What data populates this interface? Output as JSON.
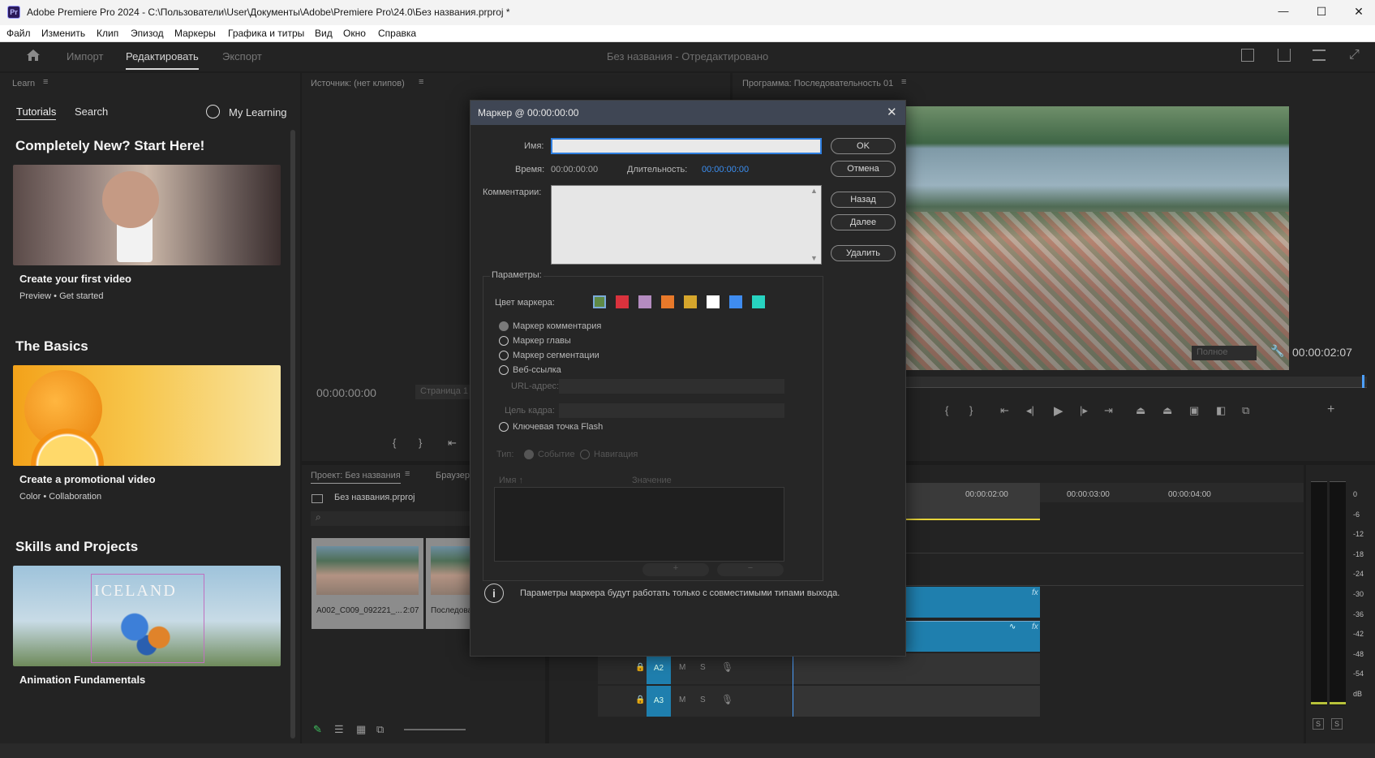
{
  "window": {
    "app_icon": "Pr",
    "title": "Adobe Premiere Pro 2024 - C:\\Пользователи\\User\\Документы\\Adobe\\Premiere Pro\\24.0\\Без названия.prproj *",
    "minimize": "—",
    "maximize": "☐",
    "close": "✕"
  },
  "menu": [
    "Файл",
    "Изменить",
    "Клип",
    "Эпизод",
    "Маркеры",
    "Графика и титры",
    "Вид",
    "Окно",
    "Справка"
  ],
  "appbar": {
    "tabs": [
      "Импорт",
      "Редактировать",
      "Экспорт"
    ],
    "active_tab": "Редактировать",
    "project_title": "Без названия  - Отредактировано"
  },
  "learn": {
    "panel_title": "Learn",
    "tabs": [
      "Tutorials",
      "Search"
    ],
    "my_learning": "My Learning",
    "sections": [
      {
        "title": "Completely New? Start Here!",
        "card_title": "Create your first video",
        "meta": [
          "Preview",
          "Get started"
        ]
      },
      {
        "title": "The Basics",
        "card_title": "Create a promotional video",
        "meta": [
          "Color",
          "Collaboration"
        ]
      },
      {
        "title": "Skills and Projects",
        "card_title": "Animation Fundamentals",
        "meta": []
      }
    ],
    "iceland_text": "ICELAND"
  },
  "source": {
    "panel_title": "Источник: (нет клипов)",
    "timecode": "00:00:00:00",
    "page_label": "Страница 1"
  },
  "program": {
    "panel_title": "Программа: Последовательность 01",
    "quality": "Полное",
    "timecode": "00:00:02:07"
  },
  "project": {
    "tab_title": "Проект: Без названия",
    "tab2": "Браузер",
    "file": "Без названия.prproj",
    "clips": [
      {
        "name": "A002_C009_092221_...",
        "duration": "2:07"
      },
      {
        "name": "Последова",
        "duration": ""
      }
    ]
  },
  "timeline": {
    "ruler": [
      "00:00:02:00",
      "00:00:03:00",
      "00:00:04:00"
    ],
    "tracks": [
      "A2",
      "A3"
    ]
  },
  "meter": {
    "ticks": [
      "0",
      "-6",
      "-12",
      "-18",
      "-24",
      "-30",
      "-36",
      "-42",
      "-48",
      "-54",
      "dB"
    ],
    "solo": [
      "S",
      "S"
    ]
  },
  "dialog": {
    "title": "Маркер @ 00:00:00:00",
    "name_label": "Имя:",
    "name_value": "",
    "time_label": "Время:",
    "time_value": "00:00:00:00",
    "duration_label": "Длительность:",
    "duration_value": "00:00:00:00",
    "comments_label": "Комментарии:",
    "buttons": {
      "ok": "OK",
      "cancel": "Отмена",
      "back": "Назад",
      "next": "Далее",
      "delete": "Удалить"
    },
    "params_label": "Параметры:",
    "color_label": "Цвет маркера:",
    "colors": [
      "#5f8a46",
      "#d9323d",
      "#b48cc0",
      "#e8792a",
      "#d6a62c",
      "#ffffff",
      "#3f8cf0",
      "#27d3c0"
    ],
    "marker_types": [
      "Маркер комментария",
      "Маркер главы",
      "Маркер сегментации",
      "Веб-ссылка"
    ],
    "url_label": "URL-адрес:",
    "frame_target_label": "Цель кадра:",
    "flash_label": "Ключевая точка Flash",
    "type_label": "Тип:",
    "type_options": [
      "Событие",
      "Навигация"
    ],
    "table_headers": [
      "Имя",
      "Значение"
    ],
    "add_btn": "+",
    "remove_btn": "−",
    "info": "Параметры маркера будут работать только с совместимыми типами выхода."
  }
}
